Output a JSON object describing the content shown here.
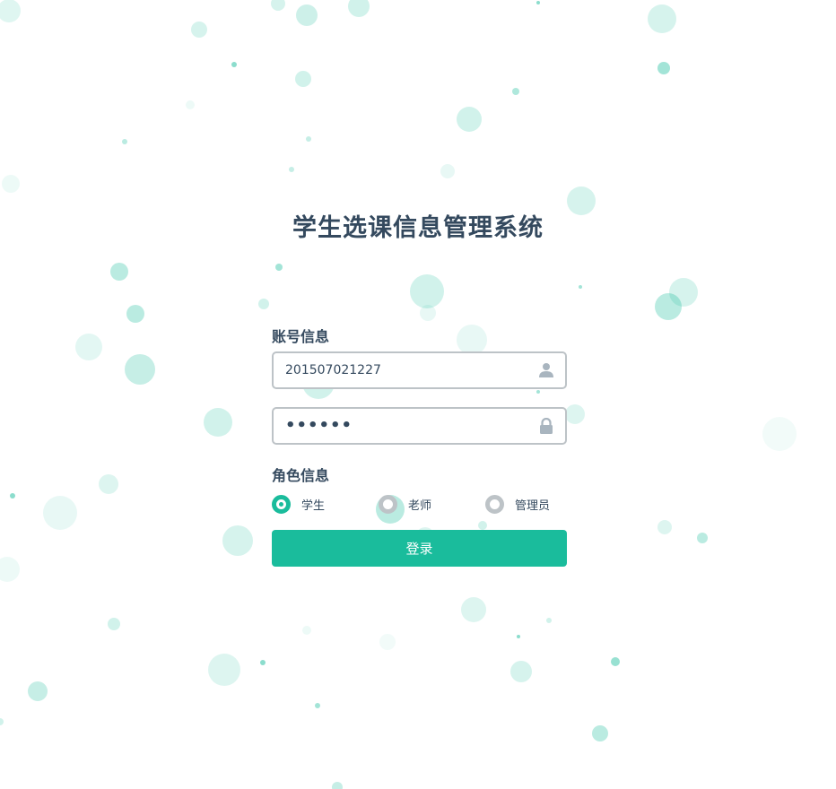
{
  "title": "学生选课信息管理系统",
  "account": {
    "section_label": "账号信息",
    "username_value": "201507021227",
    "username_icon": "user-icon",
    "password_value": "••••••",
    "password_icon": "lock-icon"
  },
  "role": {
    "section_label": "角色信息",
    "options": [
      {
        "label": "学生",
        "checked": true
      },
      {
        "label": "老师",
        "checked": false
      },
      {
        "label": "管理员",
        "checked": false
      }
    ]
  },
  "login_button_label": "登录",
  "colors": {
    "accent": "#1abc9c",
    "text": "#34495e",
    "border": "#bdc3c7",
    "icon": "#a9b5bf",
    "background": "#ffffff"
  }
}
